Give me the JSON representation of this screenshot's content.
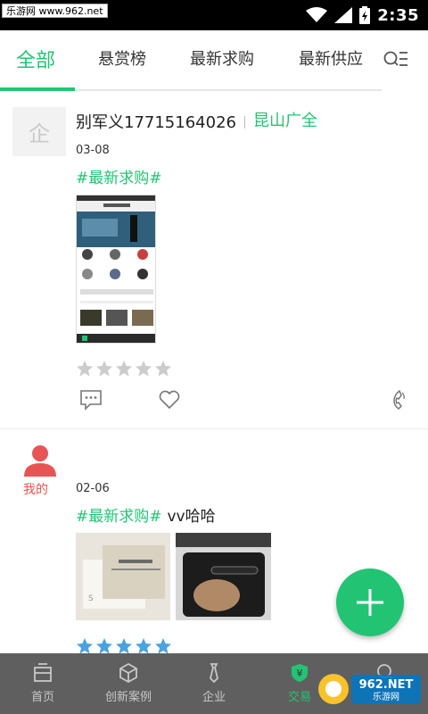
{
  "statusbar": {
    "watermark": "乐游网 www.962.net",
    "time": "2:35"
  },
  "tabs": [
    {
      "label": "全部",
      "active": true
    },
    {
      "label": "悬赏榜"
    },
    {
      "label": "最新求购"
    },
    {
      "label": "最新供应"
    }
  ],
  "posts": [
    {
      "avatar_char": "企",
      "name": "别军义17715164026",
      "location": "昆山广全",
      "date": "03-08",
      "tag": "#最新求购#",
      "extra": "",
      "rating": 0
    },
    {
      "my_label": "我的",
      "date": "02-06",
      "tag": "#最新求购#",
      "extra": "vv哈哈",
      "rating": 5
    }
  ],
  "bottom_nav": [
    {
      "label": "首页",
      "icon": "home-icon"
    },
    {
      "label": "创新案例",
      "icon": "box-icon"
    },
    {
      "label": "企业",
      "icon": "tie-icon"
    },
    {
      "label": "交易",
      "icon": "trade-shield-icon",
      "active": true
    },
    {
      "label": "",
      "icon": "search-icon"
    }
  ],
  "watermark_br": "962.NET 乐游网",
  "colors": {
    "accent": "#22c474",
    "star_empty": "#cccccc",
    "star_full": "#4aa3e0",
    "my_red": "#e85454"
  }
}
